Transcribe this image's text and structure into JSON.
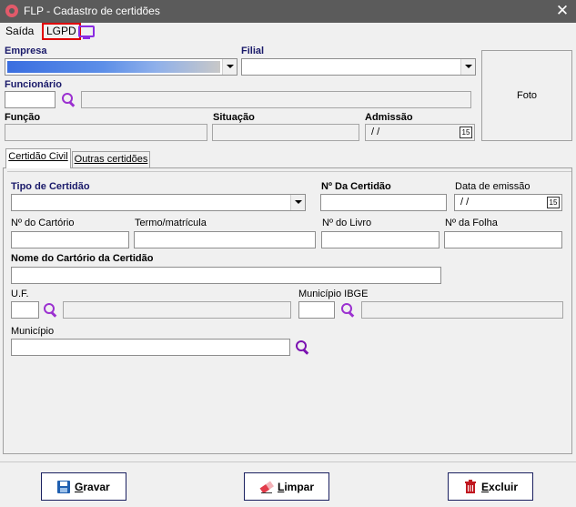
{
  "window": {
    "title": "FLP - Cadastro de certidões",
    "close_symbol": "✕"
  },
  "menu": {
    "saida": "Saída",
    "lgpd": "LGPD"
  },
  "header": {
    "empresa_label": "Empresa",
    "filial_label": "Filial",
    "funcionario_label": "Funcionário",
    "funcao_label": "Função",
    "situacao_label": "Situação",
    "admissao_label": "Admissão",
    "admissao_value": "/ /",
    "foto_label": "Foto",
    "calendar_day": "15"
  },
  "tabs": [
    {
      "label": "Certidão Civil",
      "active": true
    },
    {
      "label": "Outras certidões",
      "active": false
    }
  ],
  "certidao": {
    "tipo_label": "Tipo de Certidão",
    "numero_label": "Nº Da Certidão",
    "data_emissao_label": "Data de emissão",
    "data_emissao_value": "/ /",
    "cartorio_num_label": "Nº do Cartório",
    "termo_label": "Termo/matrícula",
    "livro_label": "Nº do Livro",
    "folha_label": "Nº da Folha",
    "nome_cartorio_label": "Nome do Cartório da Certidão",
    "uf_label": "U.F.",
    "municipio_ibge_label": "Município IBGE",
    "municipio_label": "Município"
  },
  "buttons": {
    "gravar": {
      "first": "G",
      "rest": "ravar"
    },
    "limpar": {
      "first": "L",
      "rest": "impar"
    },
    "excluir": {
      "first": "E",
      "rest": "xcluir"
    }
  },
  "colors": {
    "titlebar": "#5b5b5b",
    "accent_purple": "#9b30d0",
    "lgpd_border": "#e00000",
    "label_navy": "#1a1a6a"
  }
}
